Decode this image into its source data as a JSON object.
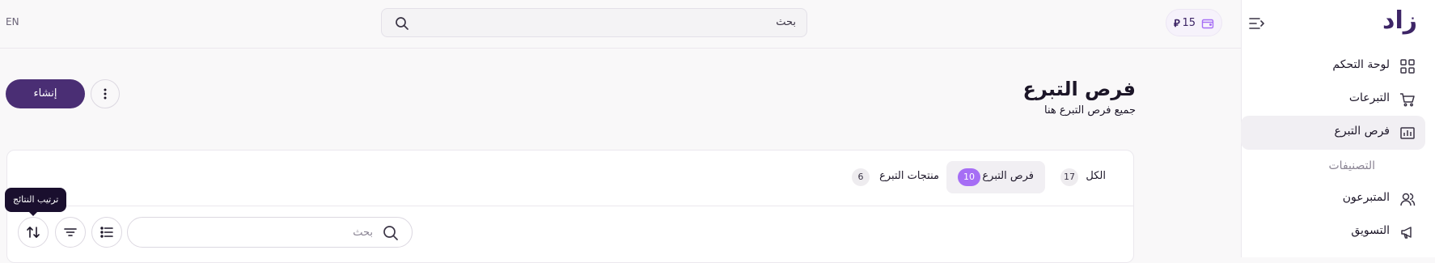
{
  "app": {
    "logo_text": "زاد",
    "lang_toggle": "EN"
  },
  "topbar": {
    "search_placeholder": "بحث",
    "wallet_amount": "15",
    "currency_symbol": "⃁"
  },
  "sidebar": {
    "items": [
      {
        "label": "لوحة التحكم",
        "icon": "dashboard-grid-icon"
      },
      {
        "label": "التبرعات",
        "icon": "cart-icon"
      },
      {
        "label": "فرص التبرع",
        "icon": "building-chart-icon"
      },
      {
        "label": "التصنيفات",
        "icon": ""
      },
      {
        "label": "المتبرعون",
        "icon": "users-icon"
      },
      {
        "label": "التسويق",
        "icon": "megaphone-icon"
      }
    ],
    "active_index": 2
  },
  "page": {
    "title": "فرص التبرع",
    "subtitle": "جميع فرص التبرع هنا",
    "create_label": "إنشاء"
  },
  "tabs": [
    {
      "label": "الكل",
      "count": "17"
    },
    {
      "label": "فرص التبرع",
      "count": "10"
    },
    {
      "label": "منتجات التبرع",
      "count": "6"
    }
  ],
  "filters": {
    "search_placeholder": "بحث",
    "sort_tooltip": "ترتيب النتائج"
  },
  "colors": {
    "brand": "#4a2e74",
    "accent_badge": "#a66ef5",
    "tooltip_bg": "#1a0f2e"
  }
}
